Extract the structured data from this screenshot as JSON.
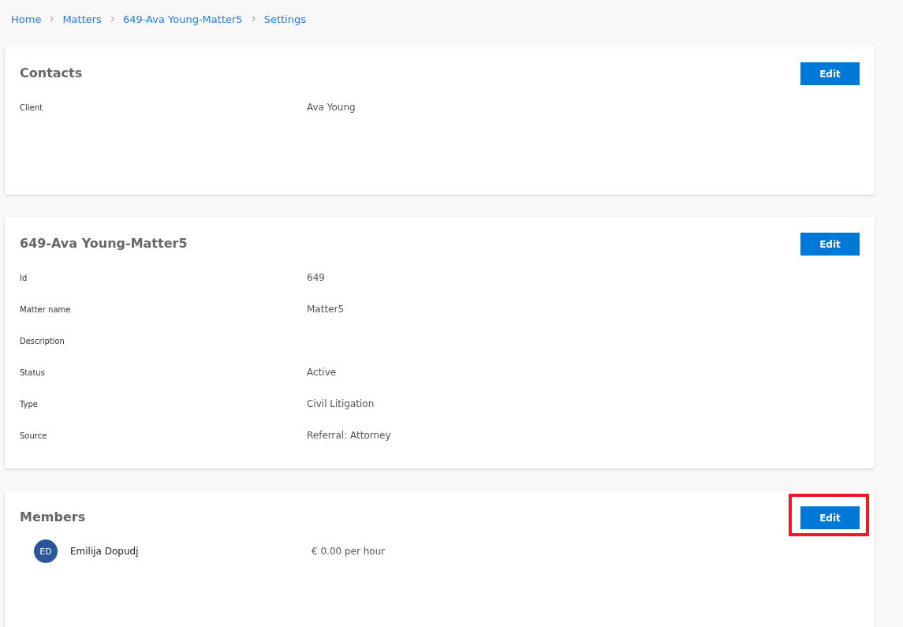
{
  "breadcrumb": [
    "Home",
    "Matters",
    "649-Ava Young-Matter5",
    "Settings"
  ],
  "sections": [
    {
      "kind": "fields",
      "title": "Contacts",
      "button": "Edit",
      "highlighted": false,
      "fields": [
        {
          "label": "Client",
          "value": "Ava Young"
        }
      ]
    },
    {
      "kind": "fields",
      "title": "649-Ava Young-Matter5",
      "button": "Edit",
      "highlighted": false,
      "fields": [
        {
          "label": "Id",
          "value": "649"
        },
        {
          "label": "Matter name",
          "value": "Matter5"
        },
        {
          "label": "Description"
        },
        {
          "label": "Status",
          "value": "Active"
        },
        {
          "label": "Type",
          "value": "Civil Litigation"
        },
        {
          "label": "Source",
          "value": "Referral: Attorney"
        }
      ]
    },
    {
      "kind": "members",
      "title": "Members",
      "button": "Edit",
      "highlighted": true,
      "members": [
        {
          "initials": "ED",
          "name": "Emilija Dopudj",
          "rate": "€ 0.00 per hour"
        }
      ]
    }
  ]
}
